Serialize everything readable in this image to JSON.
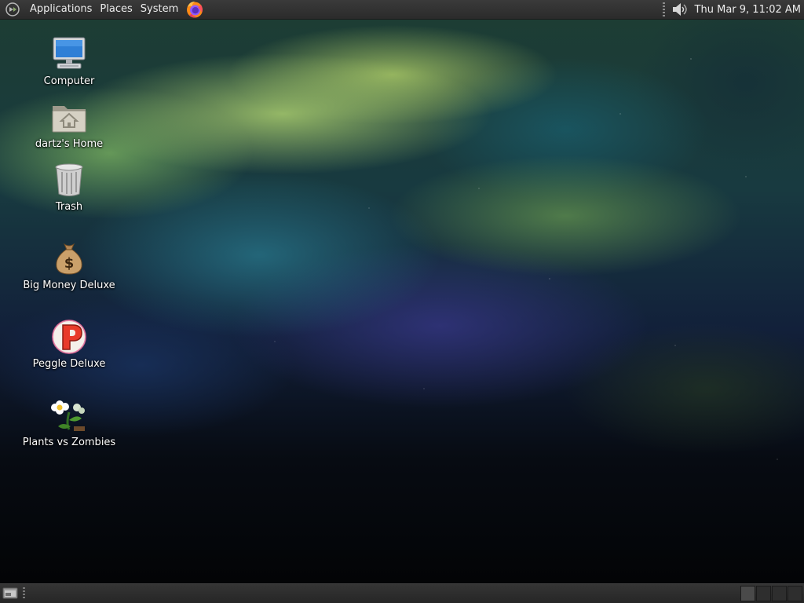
{
  "top_panel": {
    "menus": [
      "Applications",
      "Places",
      "System"
    ],
    "launcher_icon": "firefox-icon",
    "tray": {
      "volume_icon": "volume-icon",
      "clock": "Thu Mar  9, 11:02 AM"
    }
  },
  "desktop": {
    "icons": [
      {
        "label": "Computer",
        "icon": "computer-icon"
      },
      {
        "label": "dartz's Home",
        "icon": "home-folder-icon"
      },
      {
        "label": "Trash",
        "icon": "trash-icon"
      },
      {
        "label": "Big Money Deluxe",
        "icon": "money-bag-icon"
      },
      {
        "label": "Peggle Deluxe",
        "icon": "peggle-icon"
      },
      {
        "label": "Plants vs Zombies",
        "icon": "plants-vs-zombies-icon"
      }
    ]
  },
  "bottom_panel": {
    "show_desktop_icon": "show-desktop-icon",
    "workspaces": 4,
    "active_workspace": 1
  }
}
